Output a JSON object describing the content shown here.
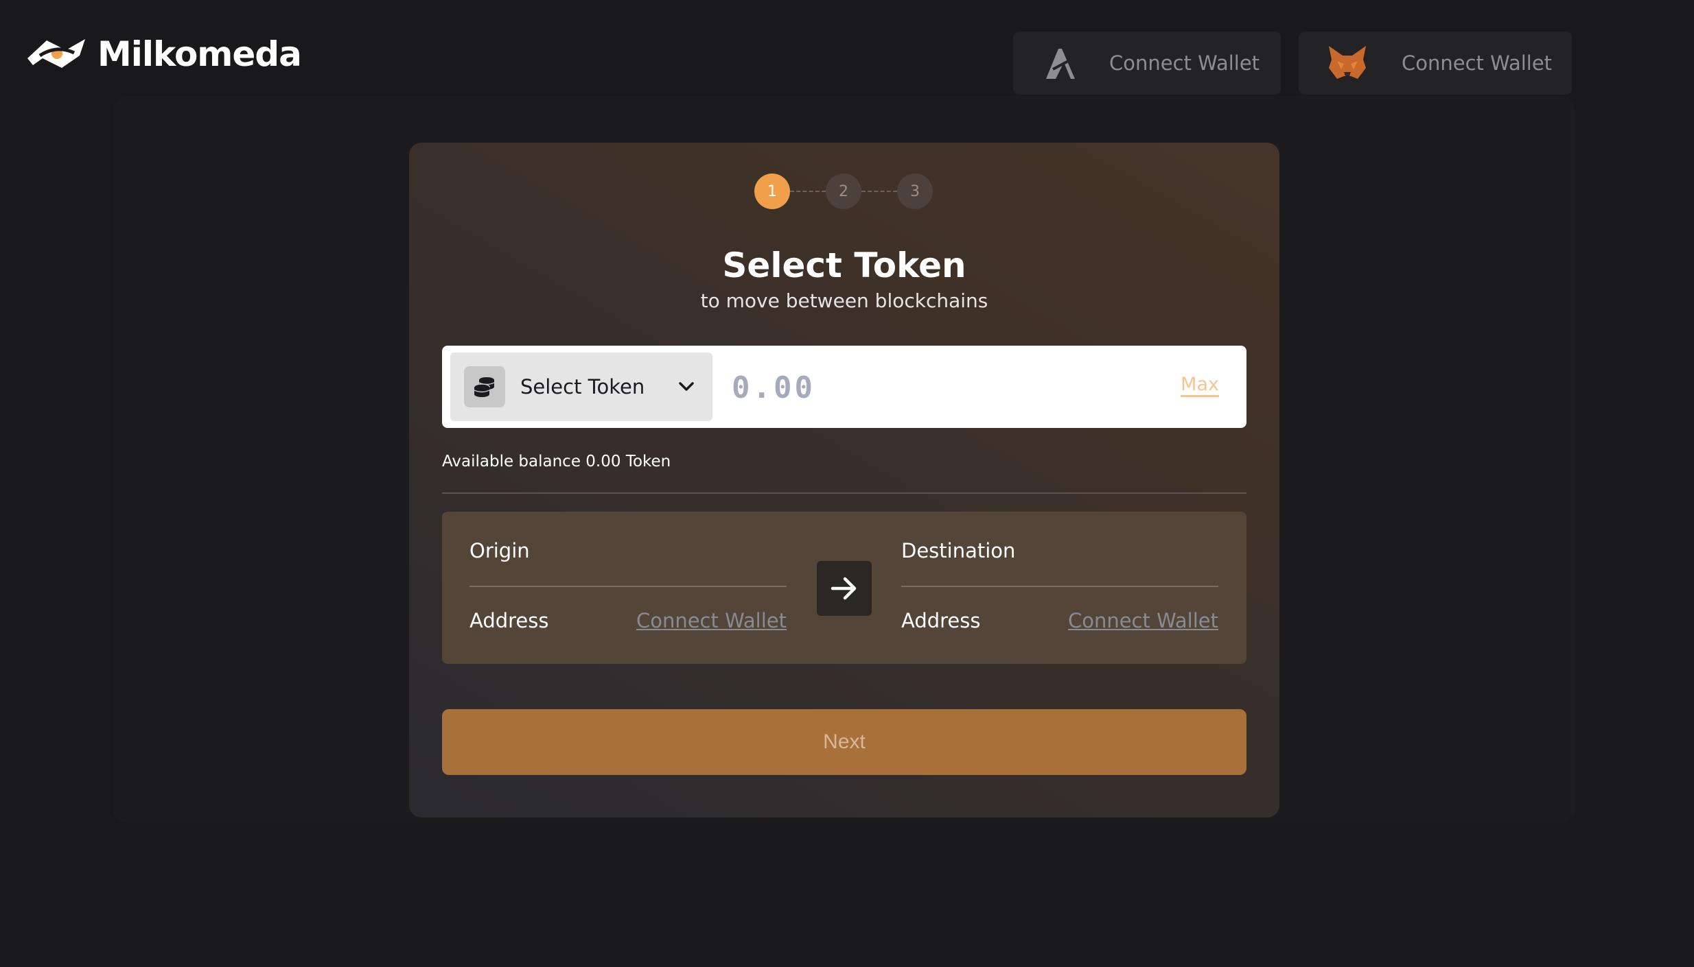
{
  "header": {
    "logo_text": "Milkomeda",
    "wallets": [
      {
        "icon": "algorand-icon",
        "label": "Connect Wallet"
      },
      {
        "icon": "metamask-fox-icon",
        "label": "Connect Wallet"
      }
    ]
  },
  "stepper": {
    "steps": [
      "1",
      "2",
      "3"
    ],
    "active_step": 1
  },
  "card": {
    "title": "Select Token",
    "subtitle": "to move between blockchains",
    "token_select": {
      "icon": "coins-stack-icon",
      "label": "Select Token"
    },
    "amount": {
      "placeholder": "0.00",
      "value": ""
    },
    "max_label": "Max",
    "balance_text": "Available balance 0.00 Token",
    "origin": {
      "label": "Origin",
      "address_label": "Address",
      "address_value": "Connect Wallet"
    },
    "destination": {
      "label": "Destination",
      "address_label": "Address",
      "address_value": "Connect Wallet"
    },
    "swap_icon": "arrow-right-icon",
    "next_label": "Next"
  },
  "colors": {
    "background": "#19191b",
    "accent": "#f0a04b",
    "next_button": "#a8713c",
    "max_link": "#f3c68f"
  }
}
